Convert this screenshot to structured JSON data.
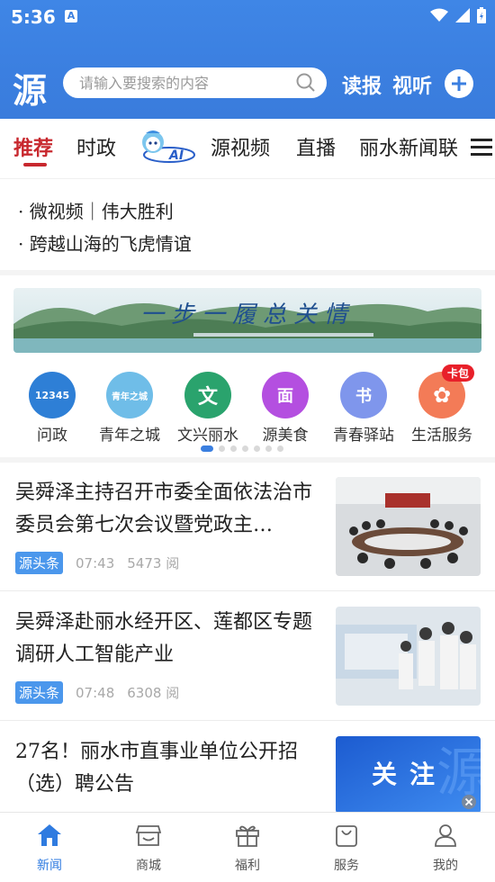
{
  "status_bar": {
    "time": "5:36"
  },
  "header": {
    "logo": "源",
    "search_placeholder": "请输入要搜索的内容",
    "links": [
      "读报",
      "视听"
    ]
  },
  "tabs": [
    {
      "label": "推荐",
      "active": true
    },
    {
      "label": "时政"
    },
    {
      "label": "AI",
      "icon": "ai-mascot-icon"
    },
    {
      "label": "源视频"
    },
    {
      "label": "直播"
    },
    {
      "label": "丽水新闻联"
    }
  ],
  "headlines": [
    "· 微视频｜伟大胜利",
    "· 跨越山海的飞虎情谊"
  ],
  "banner": {
    "text": "一步一履总关情"
  },
  "services": [
    {
      "label": "问政",
      "icon_text": "12345",
      "color": "#2e7fd6"
    },
    {
      "label": "青年之城",
      "icon_text": "青年之城",
      "color": "#6fbde8"
    },
    {
      "label": "文兴丽水",
      "icon_text": "文",
      "color": "#2aa36d"
    },
    {
      "label": "源美食",
      "icon_text": "面",
      "color": "#b44fe0"
    },
    {
      "label": "青春驿站",
      "icon_text": "书",
      "color": "#7f96ec"
    },
    {
      "label": "生活服务",
      "icon_text": "✿",
      "color": "#f37b57",
      "badge": "卡包"
    }
  ],
  "news": [
    {
      "title": "吴舜泽主持召开市委全面依法治市委员会第七次会议暨党政主…",
      "source": "源头条",
      "time": "07:43",
      "reads": "5473 阅"
    },
    {
      "title": "吴舜泽赴丽水经开区、莲都区专题调研人工智能产业",
      "source": "源头条",
      "time": "07:48",
      "reads": "6308 阅"
    },
    {
      "title": "27名！丽水市直事业单位公开招（选）聘公告",
      "image_text": "关注"
    }
  ],
  "bottom_nav": [
    {
      "label": "新闻",
      "icon": "home-icon",
      "active": true
    },
    {
      "label": "商城",
      "icon": "store-icon"
    },
    {
      "label": "福利",
      "icon": "gift-icon"
    },
    {
      "label": "服务",
      "icon": "bag-icon"
    },
    {
      "label": "我的",
      "icon": "user-icon"
    }
  ],
  "colors": {
    "brand_blue": "#3b7fe0",
    "active_red": "#c8282e"
  }
}
